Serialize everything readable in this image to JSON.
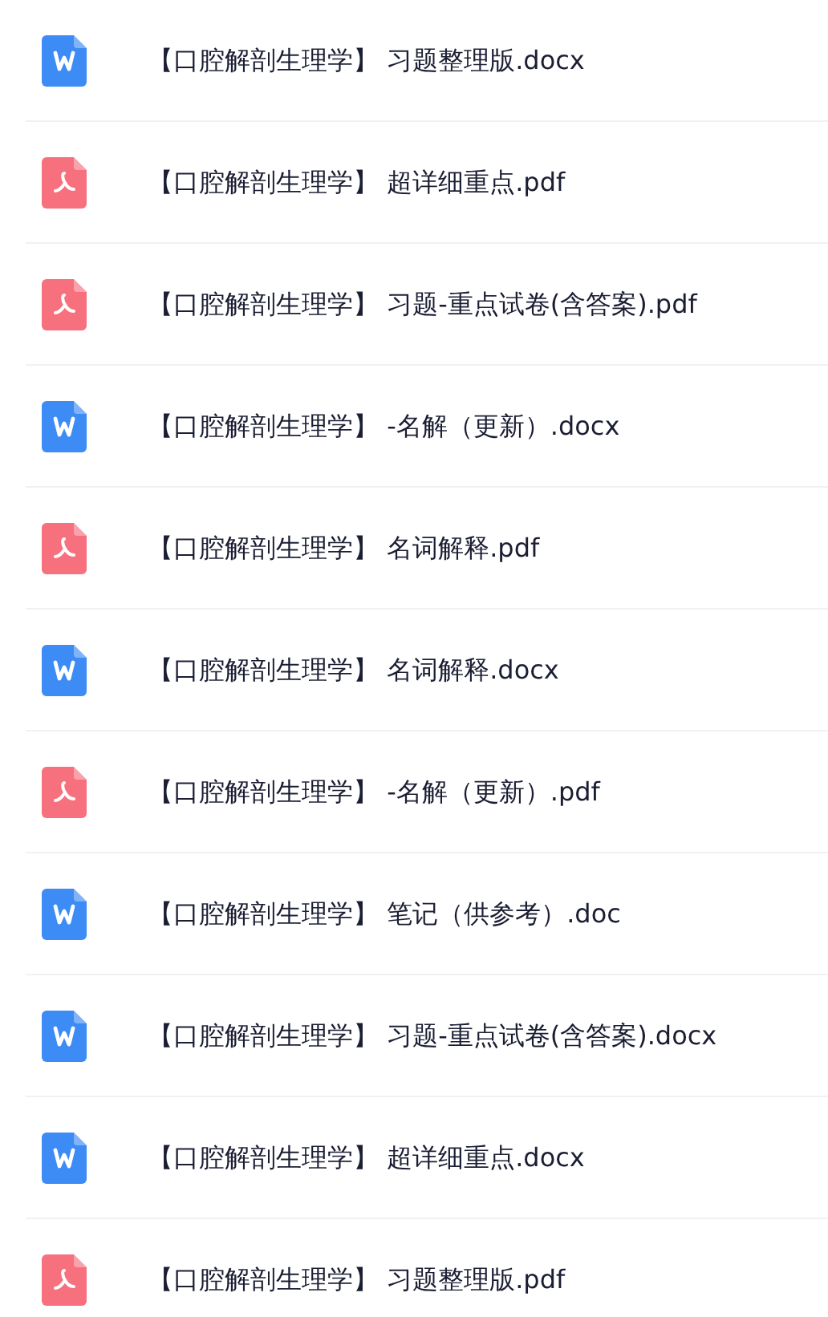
{
  "files": [
    {
      "kind": "word",
      "name": "【口腔解剖生理学】 习题整理版.docx"
    },
    {
      "kind": "pdf",
      "name": "【口腔解剖生理学】 超详细重点.pdf"
    },
    {
      "kind": "pdf",
      "name": "【口腔解剖生理学】 习题-重点试卷(含答案).pdf"
    },
    {
      "kind": "word",
      "name": "【口腔解剖生理学】 -名解（更新）.docx"
    },
    {
      "kind": "pdf",
      "name": "【口腔解剖生理学】 名词解释.pdf"
    },
    {
      "kind": "word",
      "name": "【口腔解剖生理学】 名词解释.docx"
    },
    {
      "kind": "pdf",
      "name": "【口腔解剖生理学】 -名解（更新）.pdf"
    },
    {
      "kind": "word",
      "name": "【口腔解剖生理学】 笔记（供参考）.doc"
    },
    {
      "kind": "word",
      "name": "【口腔解剖生理学】 习题-重点试卷(含答案).docx"
    },
    {
      "kind": "word",
      "name": "【口腔解剖生理学】 超详细重点.docx"
    },
    {
      "kind": "pdf",
      "name": "【口腔解剖生理学】 习题整理版.pdf"
    }
  ]
}
